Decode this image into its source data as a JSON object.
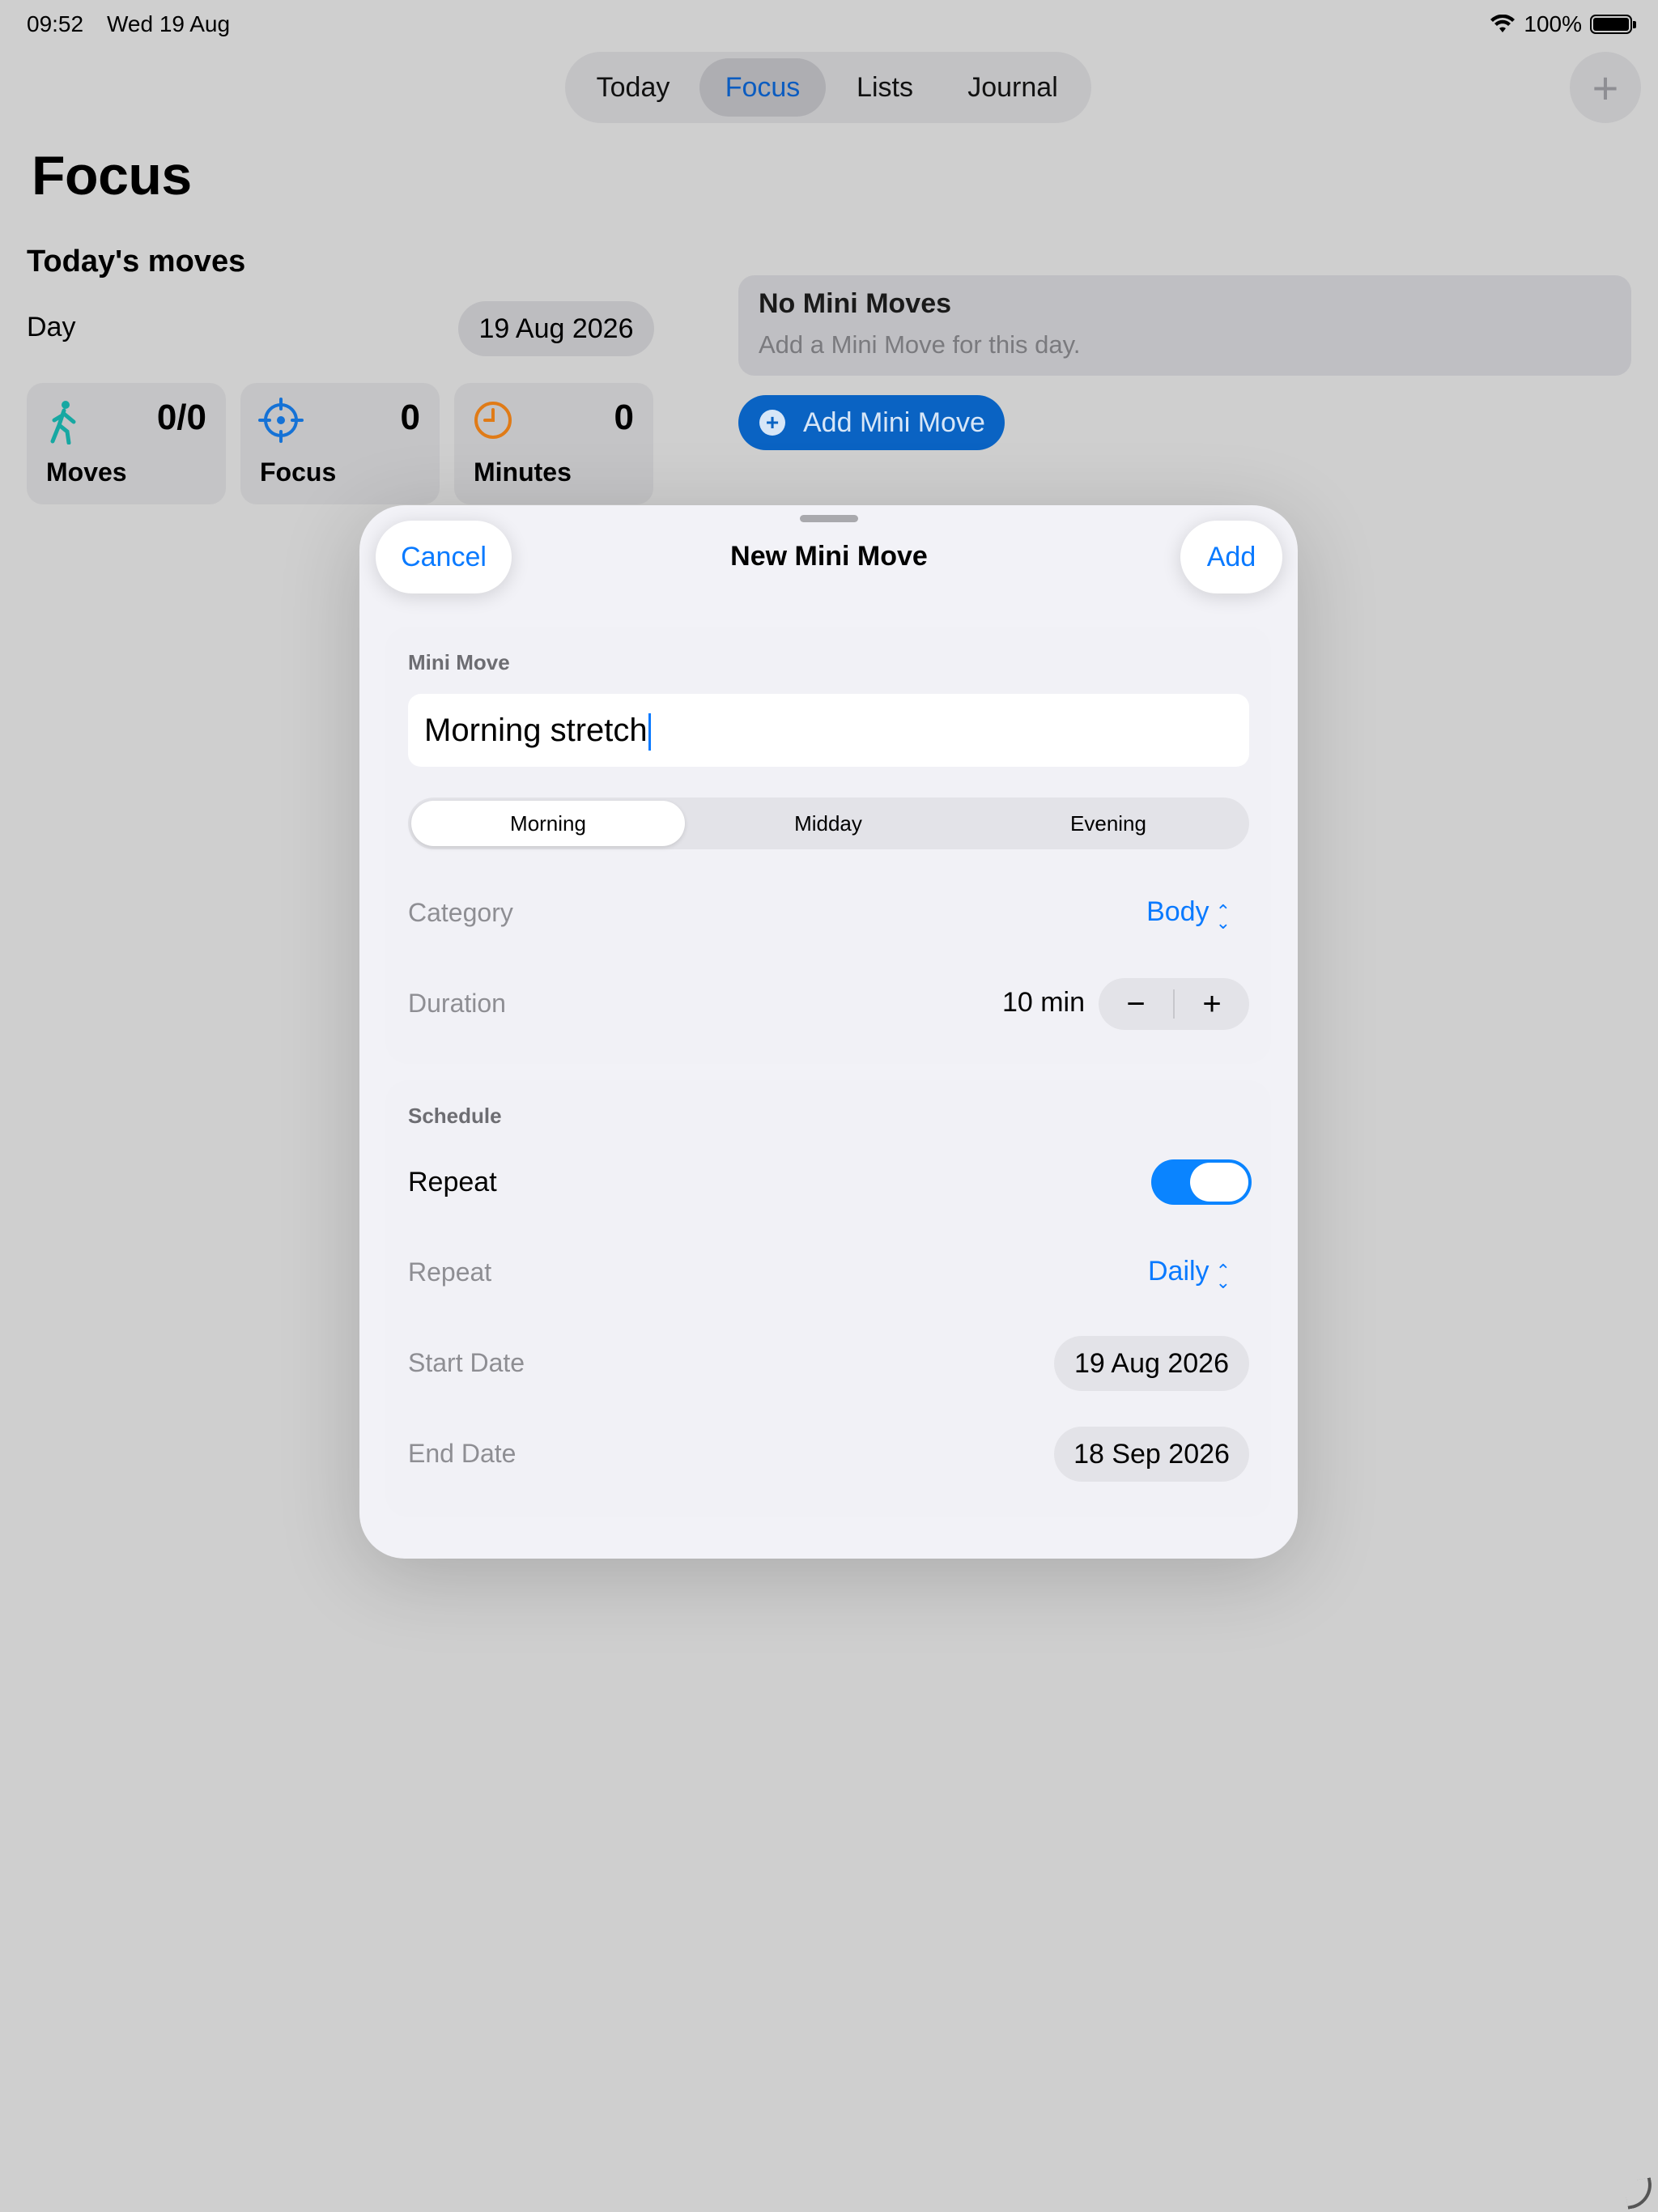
{
  "status": {
    "time": "09:52",
    "date": "Wed 19 Aug",
    "battery": "100%"
  },
  "tabs": [
    {
      "label": "Today"
    },
    {
      "label": "Focus"
    },
    {
      "label": "Lists"
    },
    {
      "label": "Journal"
    }
  ],
  "page": {
    "title": "Focus",
    "section_title": "Today's moves",
    "day_label": "Day",
    "day_value": "19 Aug 2026"
  },
  "stats": [
    {
      "value": "0/0",
      "label": "Moves",
      "icon": "walking-figure-icon",
      "color": "#17a8a2"
    },
    {
      "value": "0",
      "label": "Focus",
      "icon": "target-icon",
      "color": "#1572d6"
    },
    {
      "value": "0",
      "label": "Minutes",
      "icon": "clock-icon",
      "color": "#e07b17"
    }
  ],
  "empty_state": {
    "title": "No Mini Moves",
    "subtitle": "Add a Mini Move for this day."
  },
  "add_button": {
    "label": "Add Mini Move",
    "icon": "plus-circle-icon"
  },
  "modal": {
    "title": "New Mini Move",
    "cancel": "Cancel",
    "add": "Add",
    "mini_move_header": "Mini Move",
    "name_value": "Morning stretch",
    "segments": [
      "Morning",
      "Midday",
      "Evening"
    ],
    "selected_segment": "Morning",
    "category_label": "Category",
    "category_value": "Body",
    "duration_label": "Duration",
    "duration_value": "10 min",
    "stepper_minus": "−",
    "stepper_plus": "+",
    "schedule_header": "Schedule",
    "repeat_toggle_label": "Repeat",
    "repeat_enabled": true,
    "repeat_label": "Repeat",
    "repeat_value": "Daily",
    "start_label": "Start Date",
    "start_value": "19 Aug 2026",
    "end_label": "End Date",
    "end_value": "18 Sep 2026"
  },
  "colors": {
    "accent": "#0a7aff",
    "add_button_bg": "#0a63c3",
    "toggle_on": "#0a84ff"
  }
}
